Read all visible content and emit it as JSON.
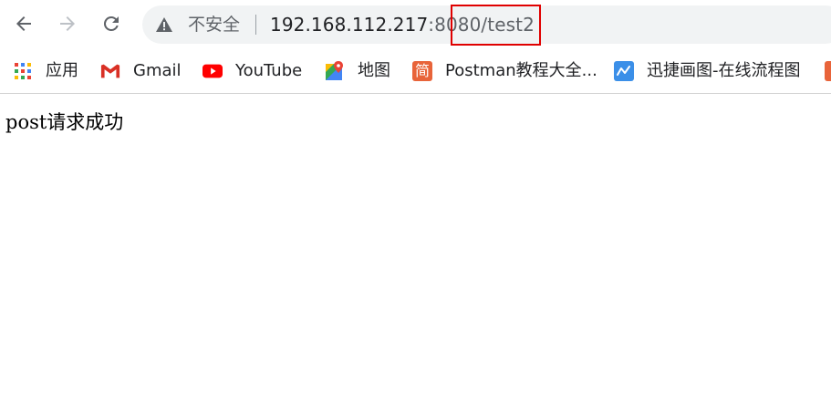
{
  "browser": {
    "omnibox": {
      "security_label": "不安全",
      "url_host": "192.168.112.217",
      "url_port": ":8080",
      "url_path": "/test2"
    },
    "bookmarks": [
      {
        "label": "应用"
      },
      {
        "label": "Gmail"
      },
      {
        "label": "YouTube"
      },
      {
        "label": "地图"
      },
      {
        "label": "Postman教程大全..."
      },
      {
        "label": "迅捷画图-在线流程图"
      }
    ],
    "postman_icon_char": "简",
    "colors": {
      "highlight": "#e00000",
      "omnibox_bg": "#f1f3f4",
      "youtube_red": "#ff0000",
      "postman_orange": "#e8643a",
      "xunjie_blue": "#3b8fe8"
    }
  },
  "page": {
    "body_text": "post请求成功"
  }
}
